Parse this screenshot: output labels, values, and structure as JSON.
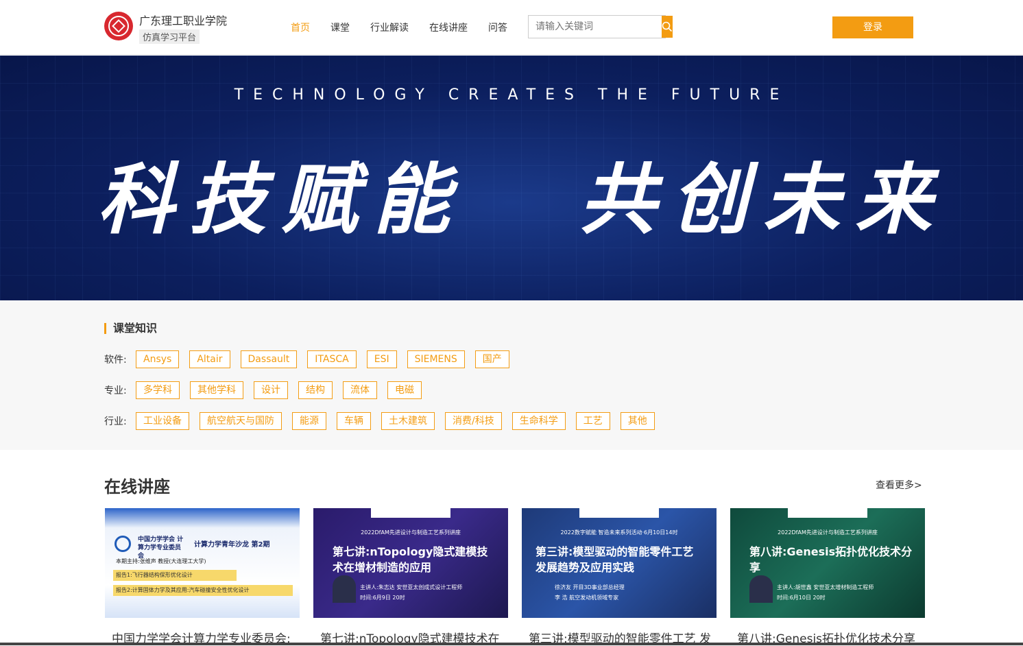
{
  "header": {
    "school_name": "广东理工职业学院",
    "platform_name": "仿真学习平台",
    "nav": [
      "首页",
      "课堂",
      "行业解读",
      "在线讲座",
      "问答"
    ],
    "active_nav": "首页",
    "search_placeholder": "请输入关键词",
    "login_label": "登录",
    "accent_color": "#f39c12"
  },
  "banner": {
    "english": "TECHNOLOGY CREATES THE FUTURE",
    "slogan_left": "科技赋能",
    "slogan_right": "共创未来"
  },
  "knowledge": {
    "title": "课堂知识",
    "software_label": "软件:",
    "software": [
      "Ansys",
      "Altair",
      "Dassault",
      "ITASCA",
      "ESI",
      "SIEMENS",
      "国产"
    ],
    "major_label": "专业:",
    "major": [
      "多学科",
      "其他学科",
      "设计",
      "结构",
      "流体",
      "电磁"
    ],
    "industry_label": "行业:",
    "industry": [
      "工业设备",
      "航空航天与国防",
      "能源",
      "车辆",
      "土木建筑",
      "消费/科技",
      "生命科学",
      "工艺",
      "其他"
    ]
  },
  "lectures": {
    "title": "在线讲座",
    "more_label": "查看更多>",
    "cards": [
      {
        "thumb_head": "中国力学学会 计算力学专业委员会",
        "thumb_main": "计算力学青年沙龙 第2期",
        "thumb_speaker": "本期主持:张维声 教授(大连理工大学)",
        "thumb_line1": "报告1:飞行器结构保形优化设计",
        "thumb_line2": "报告2:计算固体力学及其应用:汽车碰撞安全性优化设计",
        "caption": "中国力学学会计算力学专业委员会:"
      },
      {
        "thumb_head": "2022DfAM先进设计与制造工艺系列讲座",
        "thumb_main": "第七讲:nTopology隐式建模技术在增材制造的应用",
        "thumb_speaker": "主讲人:朱志达 安世亚太创成式设计工程师",
        "thumb_time": "时间:6月9日 20时",
        "caption": "第七讲:nTopology隐式建模技术在"
      },
      {
        "thumb_head": "2022数字赋能 智造未来系列活动·6月10日14时",
        "thumb_main": "第三讲:模型驱动的智能零件工艺发展趋势及应用实践",
        "thumb_speaker": "徐济友 开目3D事业部总经理",
        "thumb_time": "李 浩 航空发动机领域专家",
        "caption": "第三讲:模型驱动的智能零件工艺 发"
      },
      {
        "thumb_head": "2022DfAM先进设计与制造工艺系列讲座",
        "thumb_main": "第八讲:Genesis拓扑优化技术分享",
        "thumb_speaker": "主讲人:胡世鑫 安世亚太增材制造工程师",
        "thumb_time": "时间:6月10日 20时",
        "caption": "第八讲:Genesis拓扑优化技术分享"
      }
    ]
  }
}
